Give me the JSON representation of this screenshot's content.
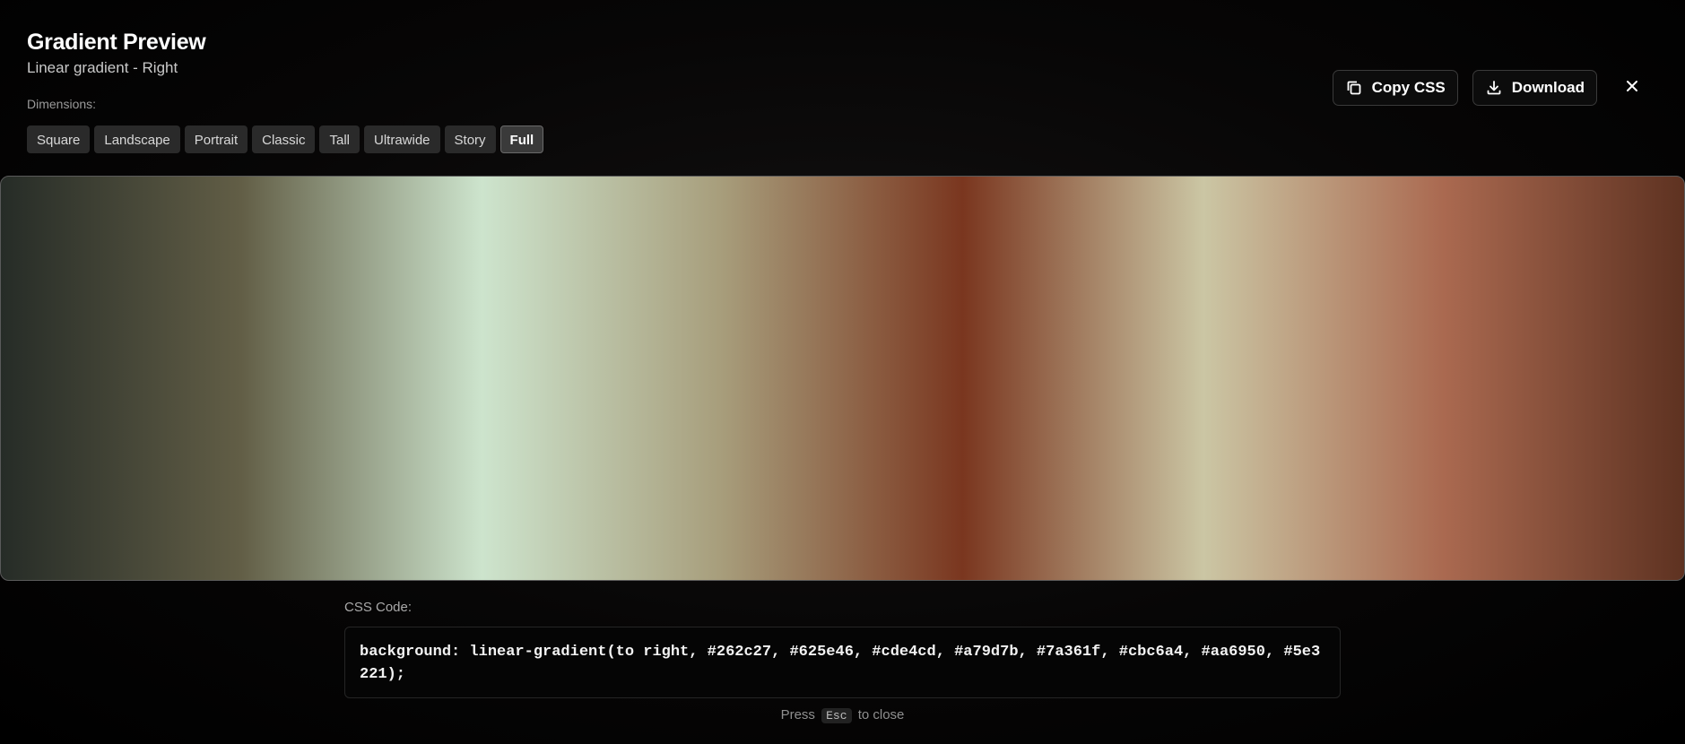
{
  "modal": {
    "title": "Gradient Preview",
    "subtitle": "Linear gradient - Right",
    "dimensions_label": "Dimensions:"
  },
  "dimensions": [
    {
      "label": "Square",
      "active": false
    },
    {
      "label": "Landscape",
      "active": false
    },
    {
      "label": "Portrait",
      "active": false
    },
    {
      "label": "Classic",
      "active": false
    },
    {
      "label": "Tall",
      "active": false
    },
    {
      "label": "Ultrawide",
      "active": false
    },
    {
      "label": "Story",
      "active": false
    },
    {
      "label": "Full",
      "active": true
    }
  ],
  "actions": {
    "copy_label": "Copy CSS",
    "copy_icon": "copy-icon",
    "download_label": "Download",
    "download_icon": "download-icon",
    "close_icon": "close-icon"
  },
  "gradient": {
    "direction": "to right",
    "colors": [
      "#262c27",
      "#625e46",
      "#cde4cd",
      "#a79d7b",
      "#7a361f",
      "#cbc6a4",
      "#aa6950",
      "#5e3221"
    ]
  },
  "code": {
    "label": "CSS Code:",
    "text": "background: linear-gradient(to right, #262c27, #625e46, #cde4cd, #a79d7b, #7a361f, #cbc6a4, #aa6950, #5e3221);"
  },
  "hint": {
    "prefix": "Press",
    "key": "Esc",
    "suffix": "to close"
  }
}
